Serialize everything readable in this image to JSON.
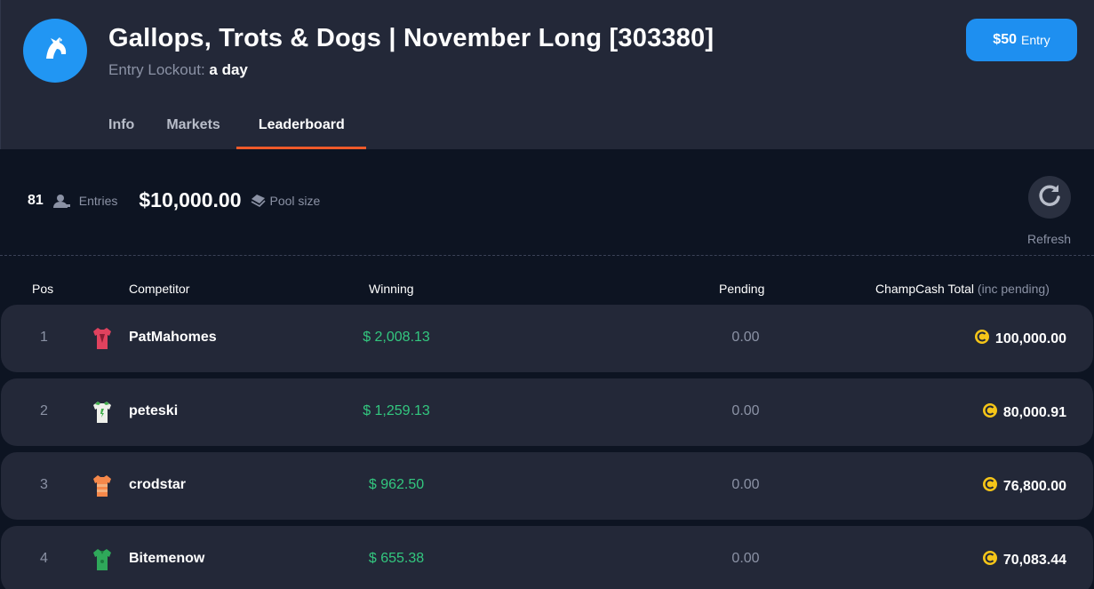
{
  "header": {
    "title": "Gallops, Trots & Dogs | November Long [303380]",
    "lockout_label": "Entry Lockout:",
    "lockout_value": "a day",
    "entry_amount": "$50",
    "entry_label": "Entry",
    "logo_icon": "horse-head-icon"
  },
  "tabs": [
    {
      "label": "Info",
      "active": false
    },
    {
      "label": "Markets",
      "active": false
    },
    {
      "label": "Leaderboard",
      "active": true
    }
  ],
  "stats": {
    "entries_count": "81",
    "entries_label": "Entries",
    "pool_value": "$10,000.00",
    "pool_label": "Pool size",
    "refresh_label": "Refresh"
  },
  "table": {
    "headers": {
      "pos": "Pos",
      "competitor": "Competitor",
      "winning": "Winning",
      "pending": "Pending",
      "total": "ChampCash Total",
      "total_note": "(inc pending)"
    },
    "rows": [
      {
        "pos": "1",
        "name": "PatMahomes",
        "winning": "$ 2,008.13",
        "pending": "0.00",
        "total": "100,000.00",
        "jersey_color": "#e0425e",
        "jersey_accent": "#8a1d33"
      },
      {
        "pos": "2",
        "name": "peteski",
        "winning": "$ 1,259.13",
        "pending": "0.00",
        "total": "80,000.91",
        "jersey_color": "#eef0ea",
        "jersey_accent": "#3fae49"
      },
      {
        "pos": "3",
        "name": "crodstar",
        "winning": "$ 962.50",
        "pending": "0.00",
        "total": "76,800.00",
        "jersey_color": "#f5884a",
        "jersey_accent": "#f2b07e"
      },
      {
        "pos": "4",
        "name": "Bitemenow",
        "winning": "$ 655.38",
        "pending": "0.00",
        "total": "70,083.44",
        "jersey_color": "#2fa85a",
        "jersey_accent": "#1c7a3e"
      }
    ]
  },
  "colors": {
    "accent_blue": "#1e8ff0",
    "tab_underline": "#ef5a2a",
    "winning_green": "#33c77f",
    "coin_gold": "#f5c518"
  }
}
